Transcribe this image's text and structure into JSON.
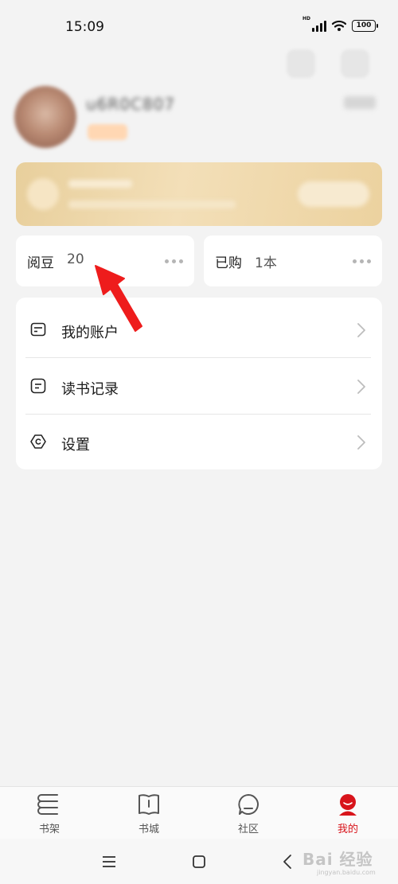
{
  "status_bar": {
    "time": "15:09",
    "battery": "100",
    "network": "HD"
  },
  "profile": {
    "username": "u6R0C807"
  },
  "stats": [
    {
      "label": "阅豆",
      "value": "20"
    },
    {
      "label": "已购",
      "value": "1本"
    }
  ],
  "menu": [
    {
      "label": "我的账户",
      "icon": "wallet-card-icon"
    },
    {
      "label": "读书记录",
      "icon": "reading-record-icon"
    },
    {
      "label": "设置",
      "icon": "settings-hex-icon"
    }
  ],
  "bottom_nav": [
    {
      "label": "书架",
      "icon": "bookshelf-icon",
      "active": false
    },
    {
      "label": "书城",
      "icon": "bookstore-icon",
      "active": false
    },
    {
      "label": "社区",
      "icon": "community-icon",
      "active": false
    },
    {
      "label": "我的",
      "icon": "profile-icon",
      "active": true
    }
  ],
  "colors": {
    "accent": "#d8141b",
    "annotation_arrow": "#ee1c1c",
    "background": "#f3f3f3"
  },
  "watermark": {
    "brand": "Bai 经验",
    "url": "jingyan.baidu.com"
  }
}
